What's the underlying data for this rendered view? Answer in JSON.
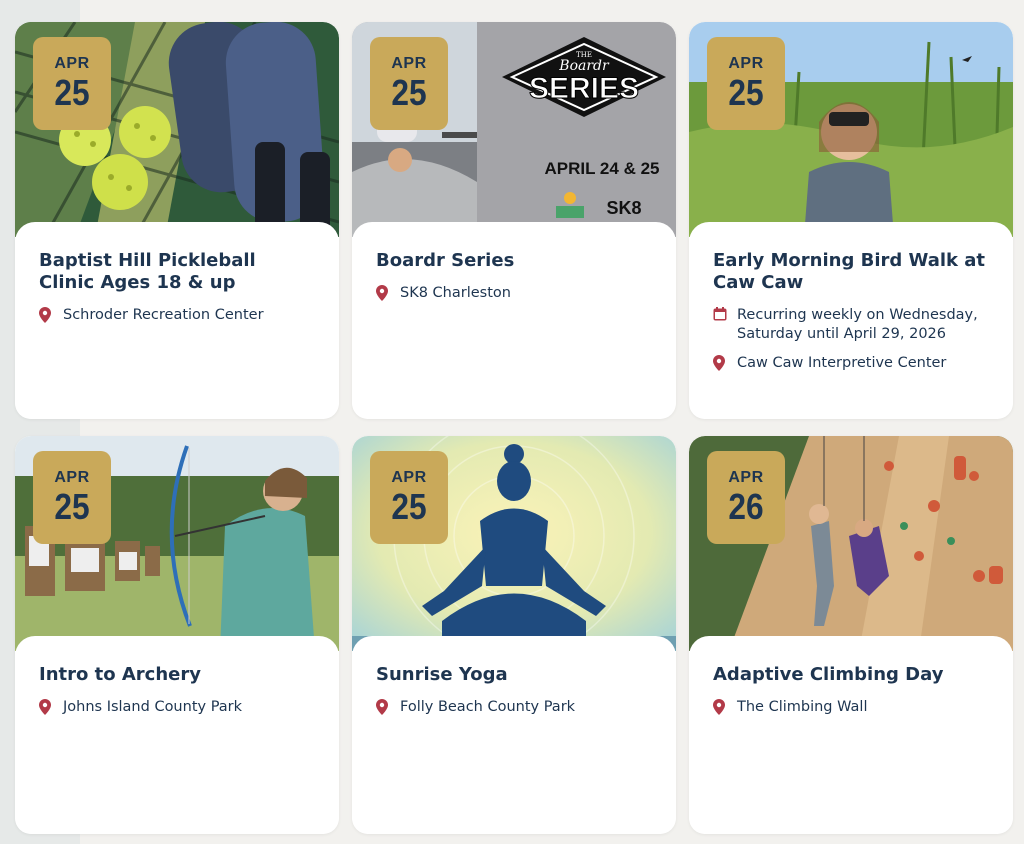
{
  "events": [
    {
      "month": "APR",
      "day": "25",
      "title": "Baptist Hill Pickleball Clinic Ages 18 & up",
      "location": "Schroder Recreation Center"
    },
    {
      "month": "APR",
      "day": "25",
      "title": "Boardr Series",
      "location": "SK8 Charleston",
      "image_text": {
        "brand_top": "THE",
        "brand_script": "Boardr",
        "brand_main": "SERIES",
        "dates": "APRIL 24 & 25",
        "logo": "SK8"
      }
    },
    {
      "month": "APR",
      "day": "25",
      "title": "Early Morning Bird Walk at Caw Caw",
      "recurrence": "Recurring weekly on Wednesday, Saturday until April 29, 2026",
      "location": "Caw Caw Interpretive Center"
    },
    {
      "month": "APR",
      "day": "25",
      "title": "Intro to Archery",
      "location": "Johns Island County Park"
    },
    {
      "month": "APR",
      "day": "25",
      "title": "Sunrise Yoga",
      "location": "Folly Beach County Park"
    },
    {
      "month": "APR",
      "day": "26",
      "title": "Adaptive Climbing Day",
      "location": "The Climbing Wall"
    }
  ],
  "icons": {
    "location": "map-pin-icon",
    "recurrence": "calendar-icon"
  },
  "colors": {
    "badge": "#c9a95a",
    "title": "#1e3550",
    "pin": "#b23a48",
    "background": "#f2f1ee"
  }
}
